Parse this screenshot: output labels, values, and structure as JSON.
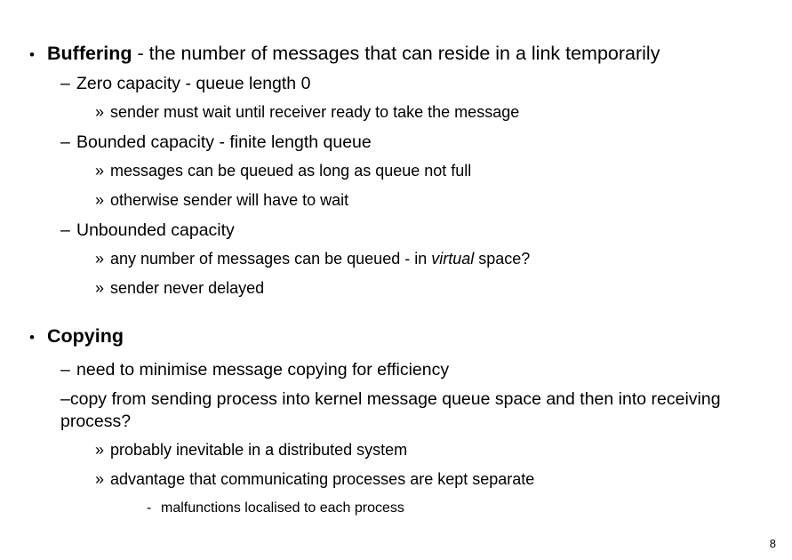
{
  "slide": {
    "page_number": "8",
    "markers": {
      "level1": "•",
      "level2": "–",
      "level3": "»",
      "level4": "-"
    },
    "blocks": [
      {
        "level": 1,
        "heading": "Buffering",
        "rest": " - the number of messages that can reside in a link temporarily"
      },
      {
        "level": 2,
        "text": "Zero capacity - queue length 0"
      },
      {
        "level": 3,
        "text": "sender must wait until receiver ready to take the message"
      },
      {
        "level": 2,
        "text": "Bounded capacity - finite length queue"
      },
      {
        "level": 3,
        "text": "messages can be queued as long as queue not full"
      },
      {
        "level": 3,
        "text": "otherwise sender will have to wait"
      },
      {
        "level": 2,
        "text": "Unbounded capacity"
      },
      {
        "level": 3,
        "pre": "any number of messages can be queued - in ",
        "italic": "virtual",
        "post": " space?"
      },
      {
        "level": 3,
        "text": "sender never delayed"
      },
      {
        "level": 1,
        "heading": "Copying",
        "rest": ""
      },
      {
        "level": 2,
        "text": "need to minimise message copying for efficiency"
      },
      {
        "level": 2,
        "text": "copy from sending process into kernel message queue space and then into receiving process?"
      },
      {
        "level": 3,
        "text": "probably inevitable in a distributed system"
      },
      {
        "level": 3,
        "text": "advantage that communicating processes are kept separate"
      },
      {
        "level": 4,
        "text": "malfunctions localised to each process"
      }
    ]
  }
}
